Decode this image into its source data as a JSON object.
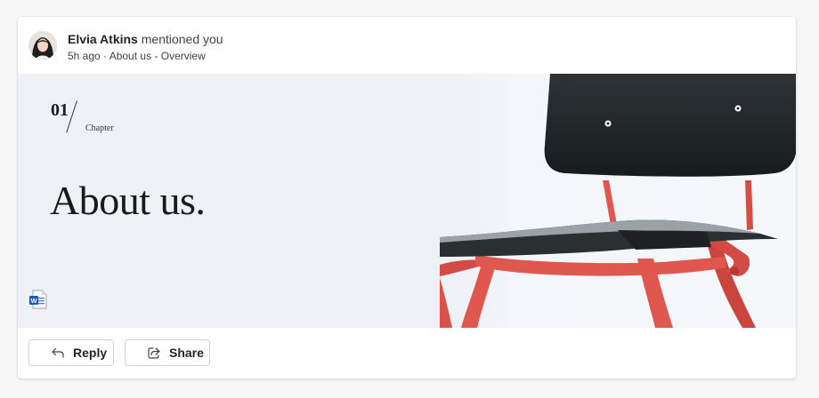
{
  "notification": {
    "author": "Elvia Atkins",
    "action": "mentioned you",
    "meta": "5h ago · About us - Overview"
  },
  "preview": {
    "chapter_number": "01",
    "chapter_label": "Chapter",
    "title": "About us.",
    "file_type_icon": "word-doc-icon"
  },
  "actions": {
    "reply_label": "Reply",
    "share_label": "Share"
  },
  "colors": {
    "chair_legs": "#e0574f",
    "chair_seat": "#23282b",
    "word_blue": "#185abd"
  }
}
